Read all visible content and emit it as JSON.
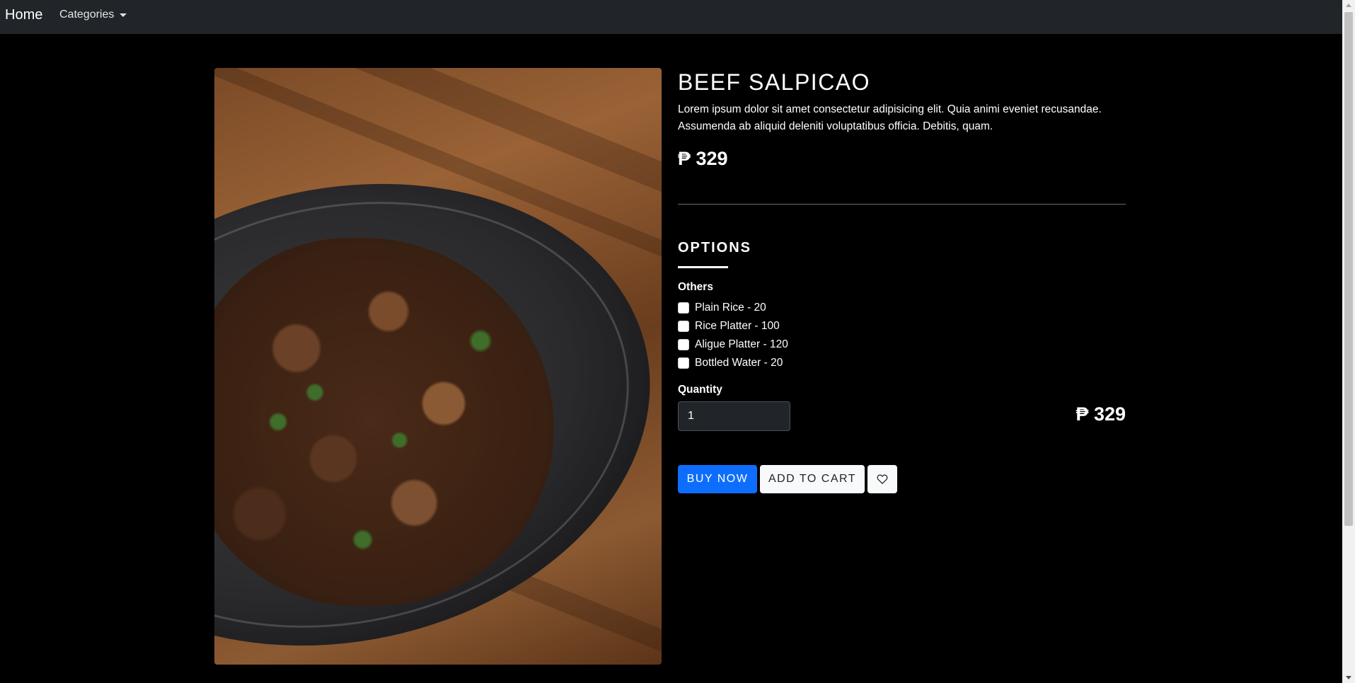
{
  "navbar": {
    "brand": "Home",
    "categories_label": "Categories"
  },
  "product": {
    "title": "BEEF SALPICAO",
    "description": "Lorem ipsum dolor sit amet consectetur adipisicing elit. Quia animi eveniet recusandae. Assumenda ab aliquid deleniti voluptatibus officia. Debitis, quam.",
    "price": "₱ 329",
    "image_alt": "Beef Salpicao"
  },
  "options": {
    "heading": "OPTIONS",
    "group_label": "Others",
    "items": [
      {
        "label": "Plain Rice - 20",
        "checked": false
      },
      {
        "label": "Rice Platter - 100",
        "checked": false
      },
      {
        "label": "Aligue Platter - 120",
        "checked": false
      },
      {
        "label": "Bottled Water - 20",
        "checked": false
      }
    ]
  },
  "quantity": {
    "label": "Quantity",
    "value": "1"
  },
  "total_price": "₱ 329",
  "actions": {
    "buy_now": "BUY NOW",
    "add_to_cart": "ADD TO CART",
    "favorite_icon": "heart-icon"
  },
  "colors": {
    "navbar_bg": "#212529",
    "page_bg": "#000000",
    "primary": "#0d6efd",
    "light_button": "#f8f9fa"
  }
}
